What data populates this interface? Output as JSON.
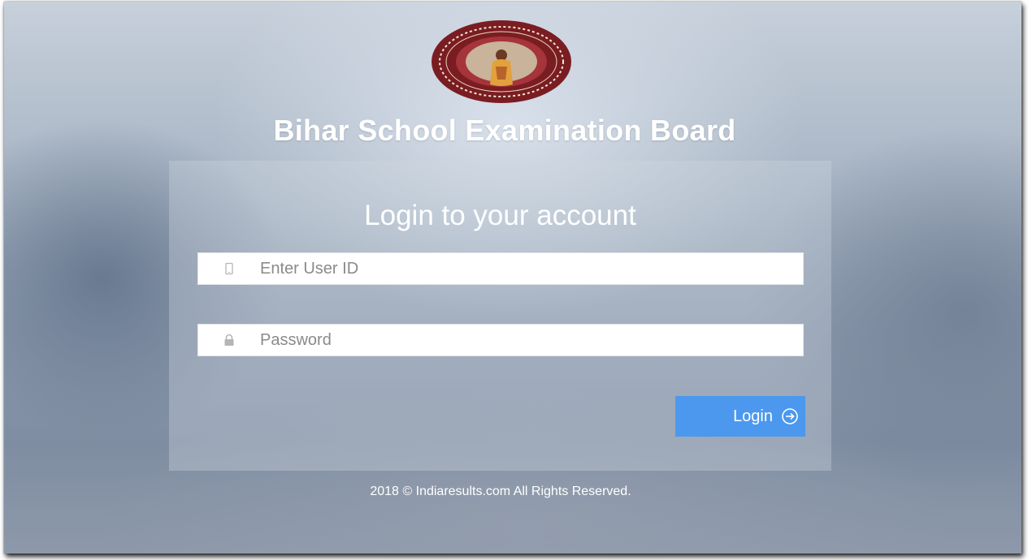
{
  "header": {
    "logo_icon": "bseb-emblem-icon",
    "title": "Bihar School Examination Board"
  },
  "login": {
    "heading": "Login to your account",
    "user_id": {
      "placeholder": "Enter User ID",
      "value": "",
      "icon": "mobile-phone-icon"
    },
    "password": {
      "placeholder": "Password",
      "value": "",
      "icon": "lock-icon"
    },
    "button_label": "Login",
    "button_icon": "arrow-circle-right-icon"
  },
  "footer": {
    "text": "2018 © Indiaresults.com All Rights Reserved."
  },
  "colors": {
    "button": "#4b98ee",
    "emblem_ring": "#7a1d22",
    "text": "#ffffff"
  }
}
